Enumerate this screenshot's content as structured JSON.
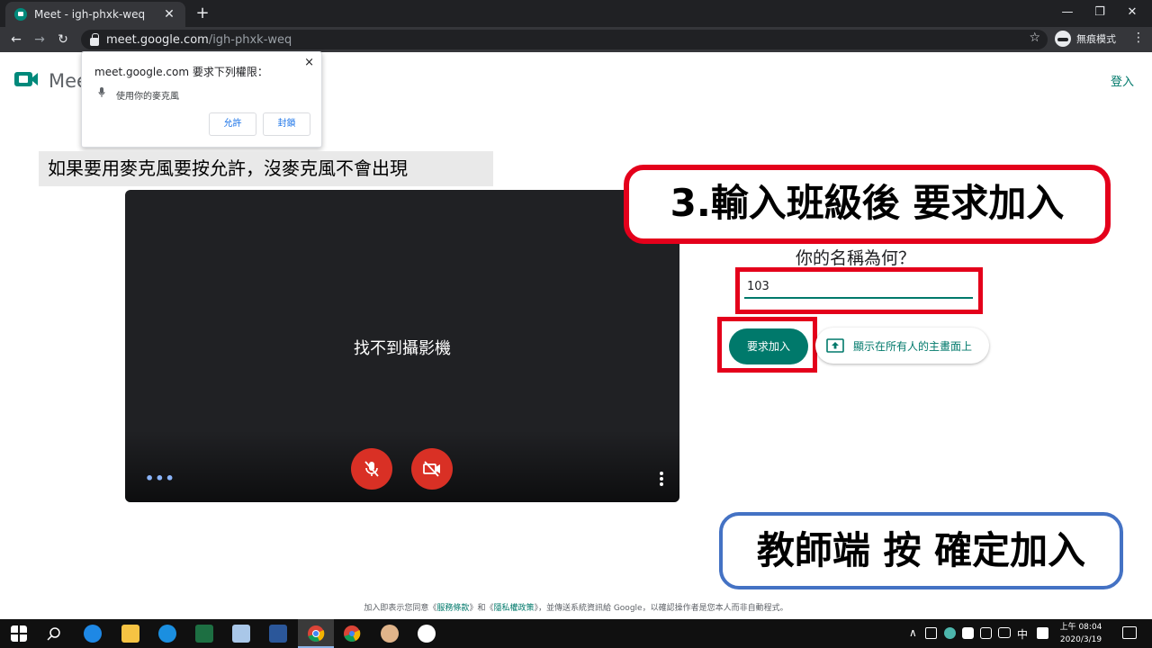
{
  "browser": {
    "tab_title": "Meet - igh-phxk-weq",
    "tab_close": "✕",
    "new_tab": "+",
    "minimize": "—",
    "maximize": "❐",
    "close": "✕",
    "back": "←",
    "forward": "→",
    "reload": "↻",
    "url_host": "meet.google.com",
    "url_path": "/igh-phxk-weq",
    "bookmark": "☆",
    "incognito_label": "無痕模式",
    "menu": "⋮"
  },
  "header": {
    "logo_text": "Mee",
    "sign_in": "登入"
  },
  "permission_popup": {
    "title": "meet.google.com 要求下列權限：",
    "close": "×",
    "item": "使用你的麥克風",
    "allow": "允許",
    "block": "封鎖"
  },
  "caption": "如果要用麥克風要按允許，沒麥克風不會出現",
  "video": {
    "message": "找不到攝影機",
    "more_dots": "•••"
  },
  "banner_red": "3.輸入班級後 要求加入",
  "form": {
    "question": "你的名稱為何？",
    "name_value": "103",
    "join_button": "要求加入",
    "present_button": "顯示在所有人的主畫面上"
  },
  "banner_blue": "教師端 按 確定加入",
  "footer": {
    "prefix": "加入即表示您同意《",
    "terms": "服務條款",
    "middle": "》和《",
    "privacy": "隱私權政策",
    "suffix": "》，並傳送系統資訊給 Google，以確認操作者是您本人而非自動程式。"
  },
  "taskbar": {
    "tray_chevron": "∧",
    "ime": "中",
    "time": "上午 08:04",
    "date": "2020/3/19"
  },
  "colors": {
    "accent_green": "#00796b",
    "annotation_red": "#e4001b",
    "annotation_blue": "#4472c4",
    "mute_red": "#d93025"
  }
}
